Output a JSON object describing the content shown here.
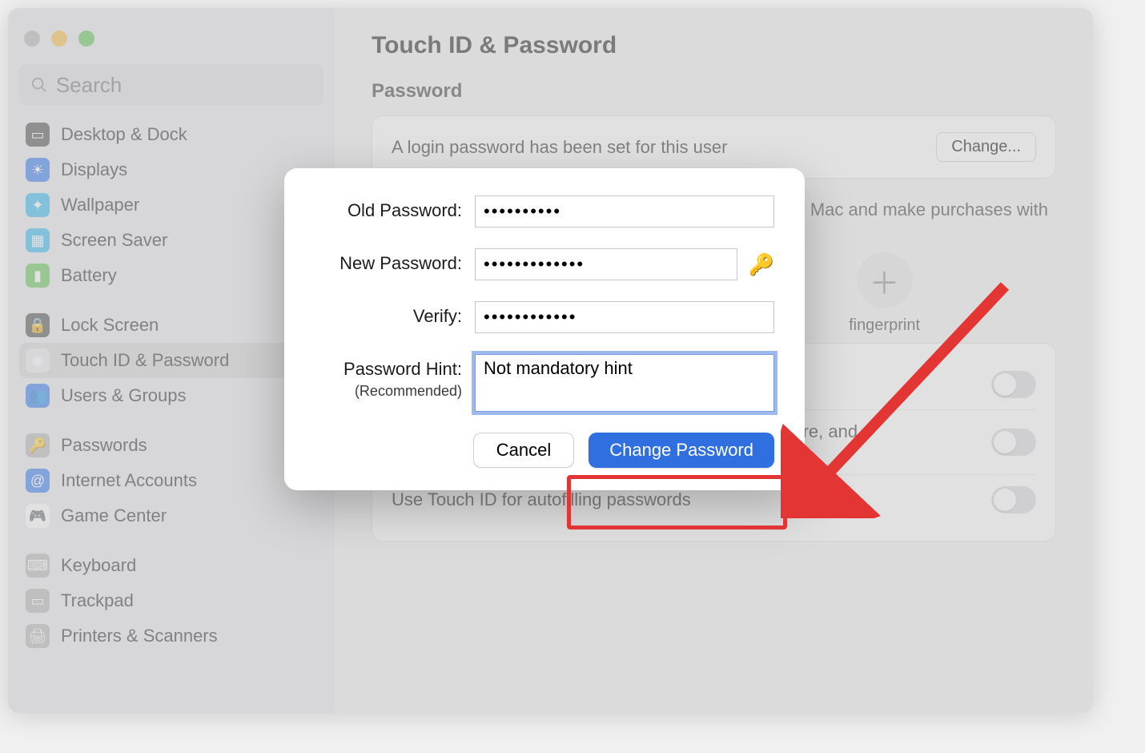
{
  "search": {
    "placeholder": "Search"
  },
  "sidebar": {
    "group1": [
      {
        "label": "Desktop & Dock",
        "icon_bg": "#4a4a4c",
        "icon_glyph": "▭"
      },
      {
        "label": "Displays",
        "icon_bg": "#2f78ef",
        "icon_glyph": "☀"
      },
      {
        "label": "Wallpaper",
        "icon_bg": "#2fb6ef",
        "icon_glyph": "✦"
      },
      {
        "label": "Screen Saver",
        "icon_bg": "#2fb6ef",
        "icon_glyph": "▦"
      },
      {
        "label": "Battery",
        "icon_bg": "#60c351",
        "icon_glyph": "▮"
      }
    ],
    "group2": [
      {
        "label": "Lock Screen",
        "icon_bg": "#4a4a4c",
        "icon_glyph": "🔒"
      },
      {
        "label": "Touch ID & Password",
        "icon_bg": "#e9e7eb",
        "icon_glyph": "◉",
        "selected": true
      },
      {
        "label": "Users & Groups",
        "icon_bg": "#2f78ef",
        "icon_glyph": "👥"
      }
    ],
    "group3": [
      {
        "label": "Passwords",
        "icon_bg": "#b3b3b5",
        "icon_glyph": "🔑"
      },
      {
        "label": "Internet Accounts",
        "icon_bg": "#2f78ef",
        "icon_glyph": "@"
      },
      {
        "label": "Game Center",
        "icon_bg": "#ffffff",
        "icon_glyph": "🎮"
      }
    ],
    "group4": [
      {
        "label": "Keyboard",
        "icon_bg": "#b3b3b5",
        "icon_glyph": "⌨"
      },
      {
        "label": "Trackpad",
        "icon_bg": "#b3b3b5",
        "icon_glyph": "▭"
      },
      {
        "label": "Printers & Scanners",
        "icon_bg": "#b3b3b5",
        "icon_glyph": "🖨"
      }
    ]
  },
  "page": {
    "title": "Touch ID & Password",
    "password_section": "Password",
    "password_status": "A login password has been set for this user",
    "change_btn": "Change...",
    "touchid_hint_tail": "Mac and make purchases with",
    "add_fingerprint_label": "fingerprint",
    "toggle_items": [
      "",
      "Use Touch ID for purchases in iTunes Store, App Store, and Apple Books",
      "Use Touch ID for autofilling passwords"
    ]
  },
  "modal": {
    "labels": {
      "old": "Old Password:",
      "new": "New Password:",
      "verify": "Verify:",
      "hint": "Password Hint:",
      "hint_sub": "(Recommended)"
    },
    "values": {
      "old": "••••••••••",
      "new": "•••••••••••••",
      "verify": "••••••••••••",
      "hint": "Not mandatory hint"
    },
    "buttons": {
      "cancel": "Cancel",
      "change": "Change Password"
    }
  }
}
